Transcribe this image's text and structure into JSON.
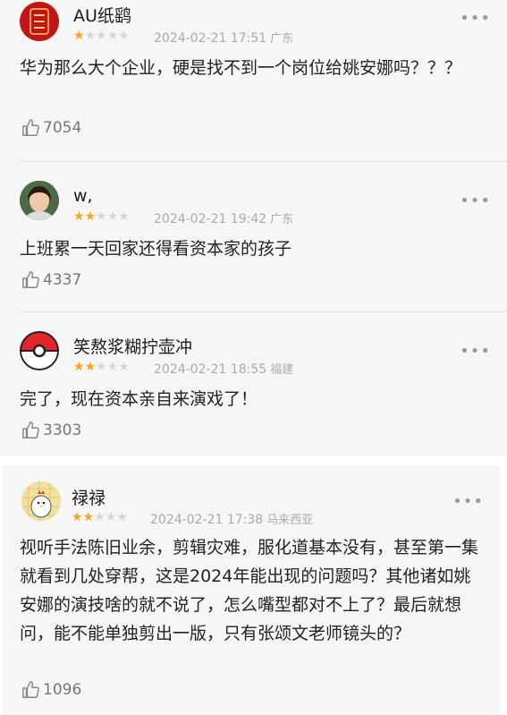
{
  "reviews": [
    {
      "user": "AU纸鹞",
      "rating": 1,
      "date": "2024-02-21 17:51",
      "location": "广东",
      "text": "华为那么大个企业，硬是找不到一个岗位给姚安娜吗？？？",
      "likes": "7054",
      "avatar": "red-seal-avatar"
    },
    {
      "user": "w,",
      "rating": 2,
      "date": "2024-02-21 19:42",
      "location": "广东",
      "text": "上班累一天回家还得看资本家的孩子",
      "likes": "4337",
      "avatar": "girl-photo-avatar"
    },
    {
      "user": "笑熬浆糊拧壶冲",
      "rating": 2,
      "date": "2024-02-21 18:55",
      "location": "福建",
      "text": "完了，现在资本亲自来演戏了！",
      "likes": "3303",
      "avatar": "pokeball-avatar"
    },
    {
      "user": "禄禄",
      "rating": 2,
      "date": "2024-02-21 17:38",
      "location": "马来西亚",
      "text": "视听手法陈旧业余，剪辑灾难，服化道基本没有，甚至第一集就看到几处穿帮，这是2024年能出现的问题吗？其他诸如姚安娜的演技啥的就不说了，怎么嘴型都对不上了？最后就想问，能不能单独剪出一版，只有张颂文老师镜头的？",
      "likes": "1096",
      "avatar": "chicken-avatar"
    }
  ],
  "more_glyph": "•••",
  "colors": {
    "star": "#f5a623",
    "star_off": "#d6d6d6",
    "meta": "#aaaaaa"
  }
}
